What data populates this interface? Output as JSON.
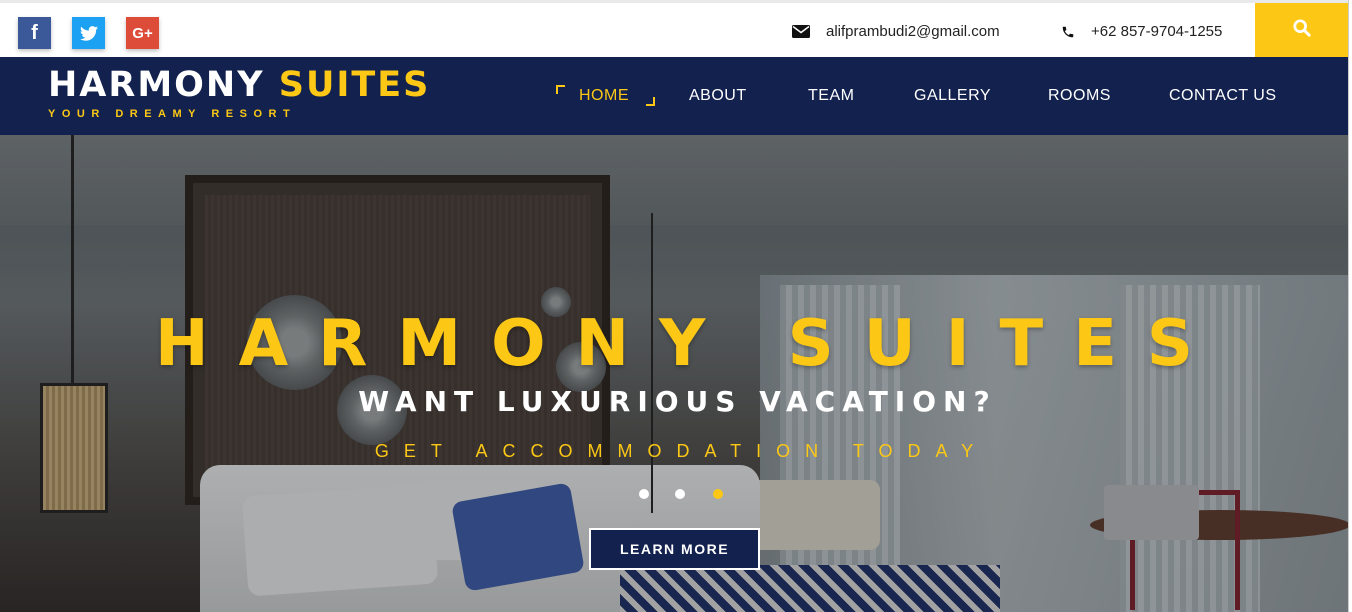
{
  "topbar": {
    "social": [
      {
        "name": "facebook",
        "glyph": "f"
      },
      {
        "name": "twitter",
        "glyph": ""
      },
      {
        "name": "google-plus",
        "glyph": "G+"
      }
    ],
    "email": "alifprambudi2@gmail.com",
    "phone": "+62 857-9704-1255"
  },
  "brand": {
    "name_part1": "HARMONY",
    "name_part2": "SUITES",
    "tagline": "YOUR DREAMY RESORT"
  },
  "nav": {
    "items": [
      {
        "label": "HOME",
        "active": true
      },
      {
        "label": "ABOUT"
      },
      {
        "label": "TEAM"
      },
      {
        "label": "GALLERY"
      },
      {
        "label": "ROOMS"
      },
      {
        "label": "CONTACT US"
      }
    ]
  },
  "hero": {
    "title": "HARMONY SUITES",
    "subtitle": "WANT LUXURIOUS VACATION?",
    "tagline": "GET ACCOMMODATION TODAY",
    "button_label": "LEARN MORE",
    "slides_count": 3,
    "active_slide": 3
  },
  "colors": {
    "navy": "#12214e",
    "accent": "#fcc815"
  }
}
